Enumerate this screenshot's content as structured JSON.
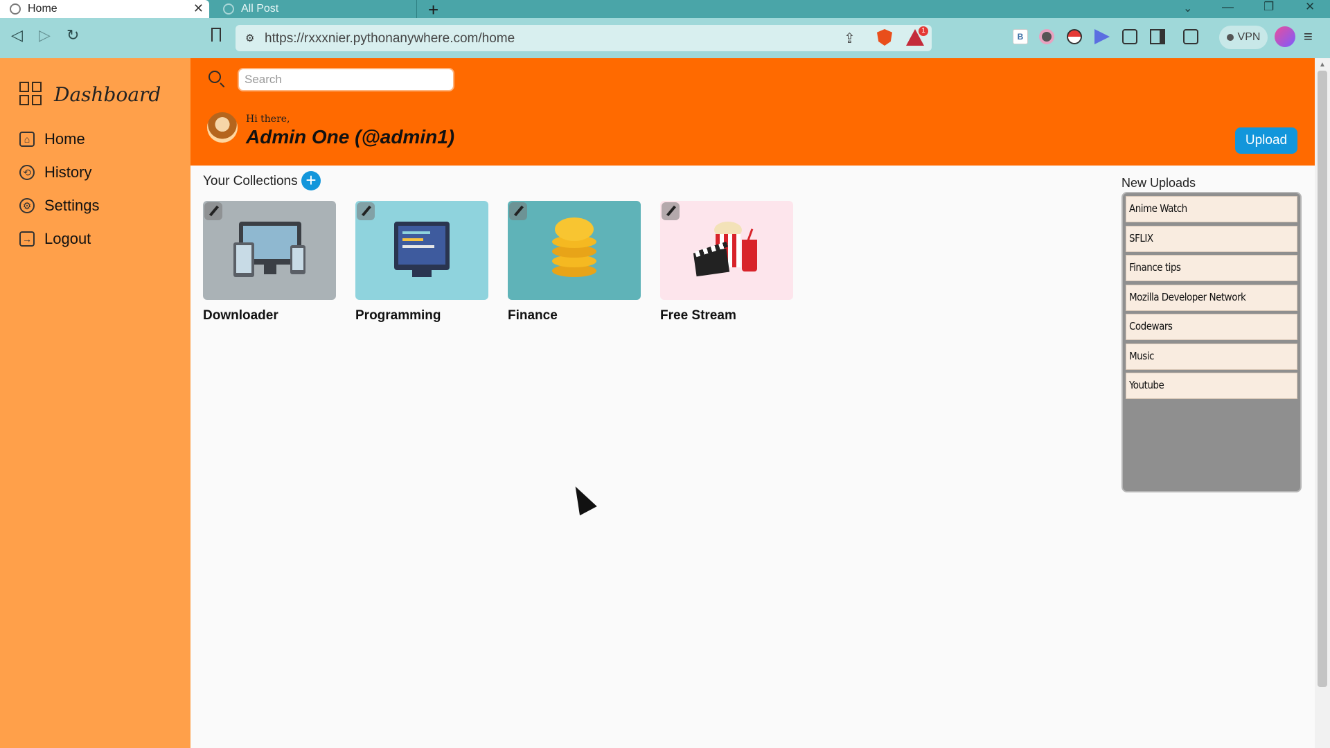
{
  "browser": {
    "tabs": [
      {
        "label": "Home",
        "active": true
      },
      {
        "label": "All Post",
        "active": false
      }
    ],
    "url": "https://rxxxnier.pythonanywhere.com/home",
    "vpn_label": "VPN",
    "rewards_badge": "1"
  },
  "sidebar": {
    "title": "Dashboard",
    "items": [
      {
        "label": "Home",
        "icon": "home-icon"
      },
      {
        "label": "History",
        "icon": "history-icon"
      },
      {
        "label": "Settings",
        "icon": "gear-icon"
      },
      {
        "label": "Logout",
        "icon": "logout-icon"
      }
    ]
  },
  "header": {
    "search_placeholder": "Search",
    "greeting": "Hi there,",
    "username": "Admin One (@admin1)",
    "upload_label": "Upload"
  },
  "collections": {
    "title": "Your Collections",
    "add_label": "+",
    "items": [
      {
        "label": "Downloader",
        "icon": "devices-icon"
      },
      {
        "label": "Programming",
        "icon": "code-monitor-icon"
      },
      {
        "label": "Finance",
        "icon": "coins-icon"
      },
      {
        "label": "Free Stream",
        "icon": "popcorn-icon"
      }
    ]
  },
  "new_uploads": {
    "title": "New Uploads",
    "items": [
      "Anime Watch",
      "SFLIX",
      "Finance tips",
      "Mozilla Developer Network",
      "Codewars",
      "Music",
      "Youtube"
    ]
  },
  "colors": {
    "sidebar": "#ffa04a",
    "header": "#ff6a00",
    "accent": "#1296db",
    "tabbar": "#4aa5a8"
  }
}
